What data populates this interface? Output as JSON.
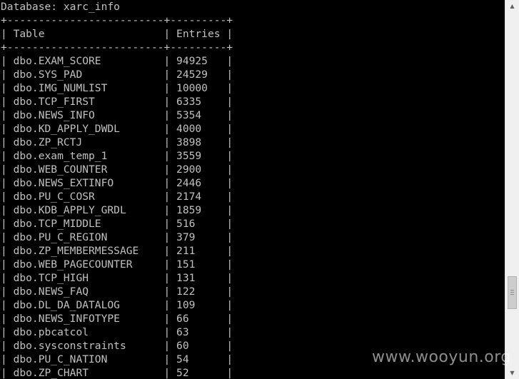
{
  "database_line": "Database: xarc_info",
  "table": {
    "border": "+-------------------------+---------+",
    "header_table": "Table",
    "header_entries": "Entries",
    "rows": [
      {
        "name": "dbo.EXAM_SCORE",
        "entries": "94925"
      },
      {
        "name": "dbo.SYS_PAD",
        "entries": "24529"
      },
      {
        "name": "dbo.IMG_NUMLIST",
        "entries": "10000"
      },
      {
        "name": "dbo.TCP_FIRST",
        "entries": "6335"
      },
      {
        "name": "dbo.NEWS_INFO",
        "entries": "5354"
      },
      {
        "name": "dbo.KD_APPLY_DWDL",
        "entries": "4000"
      },
      {
        "name": "dbo.ZP_RCTJ",
        "entries": "3898"
      },
      {
        "name": "dbo.exam_temp_1",
        "entries": "3559"
      },
      {
        "name": "dbo.WEB_COUNTER",
        "entries": "2900"
      },
      {
        "name": "dbo.NEWS_EXTINFO",
        "entries": "2446"
      },
      {
        "name": "dbo.PU_C_COSR",
        "entries": "2174"
      },
      {
        "name": "dbo.KDB_APPLY_GRDL",
        "entries": "1859"
      },
      {
        "name": "dbo.TCP_MIDDLE",
        "entries": "516"
      },
      {
        "name": "dbo.PU_C_REGION",
        "entries": "379"
      },
      {
        "name": "dbo.ZP_MEMBERMESSAGE",
        "entries": "211"
      },
      {
        "name": "dbo.WEB_PAGECOUNTER",
        "entries": "151"
      },
      {
        "name": "dbo.TCP_HIGH",
        "entries": "131"
      },
      {
        "name": "dbo.NEWS_FAQ",
        "entries": "122"
      },
      {
        "name": "dbo.DL_DA_DATALOG",
        "entries": "109"
      },
      {
        "name": "dbo.NEWS_INFOTYPE",
        "entries": "66"
      },
      {
        "name": "dbo.pbcatcol",
        "entries": "63"
      },
      {
        "name": "dbo.sysconstraints",
        "entries": "60"
      },
      {
        "name": "dbo.PU_C_NATION",
        "entries": "54"
      },
      {
        "name": "dbo.ZP_CHART",
        "entries": "52"
      }
    ]
  },
  "watermark": "www.wooyun.org",
  "colors": {
    "background": "#000000",
    "text": "#c0c0c0",
    "scrollbar_track": "#f0f0f0",
    "scrollbar_thumb": "#cdcdcd"
  },
  "icons": {
    "scroll_up": "chevron-up-icon",
    "scroll_down": "chevron-down-icon"
  }
}
